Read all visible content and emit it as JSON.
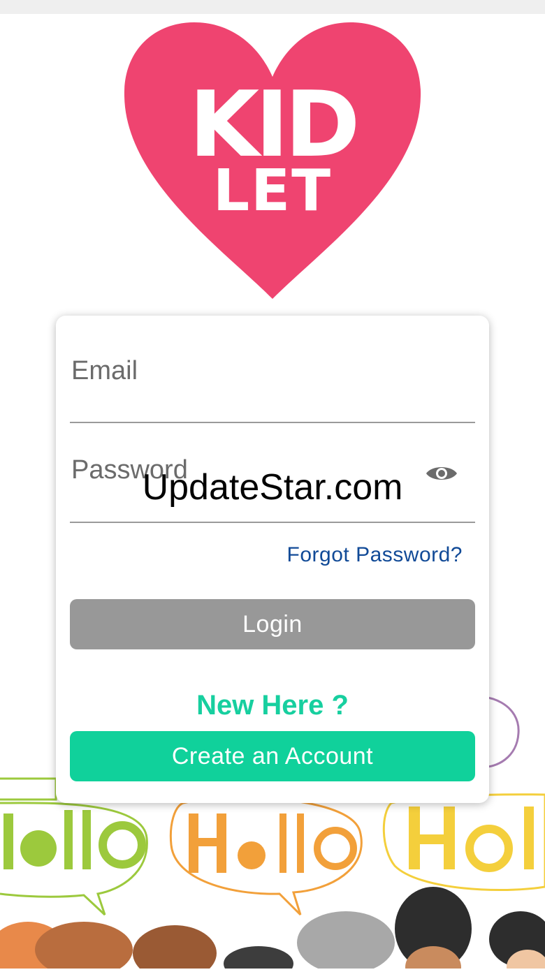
{
  "logo": {
    "line1": "KID",
    "line2": "LET",
    "heart_color": "#ef4470"
  },
  "form": {
    "email_placeholder": "Email",
    "password_placeholder": "Password",
    "show_password_icon": "eye-icon",
    "forgot_password_label": "Forgot Password?",
    "login_label": "Login",
    "new_here_text": "New Here ?",
    "create_account_label": "Create an Account"
  },
  "illustration": {
    "greetings": [
      "Hallo",
      "Hello",
      "Hola"
    ]
  },
  "watermark": "UpdateStar.com",
  "colors": {
    "accent_green": "#10d19b",
    "link_blue": "#114a97",
    "login_gray": "#989898"
  }
}
